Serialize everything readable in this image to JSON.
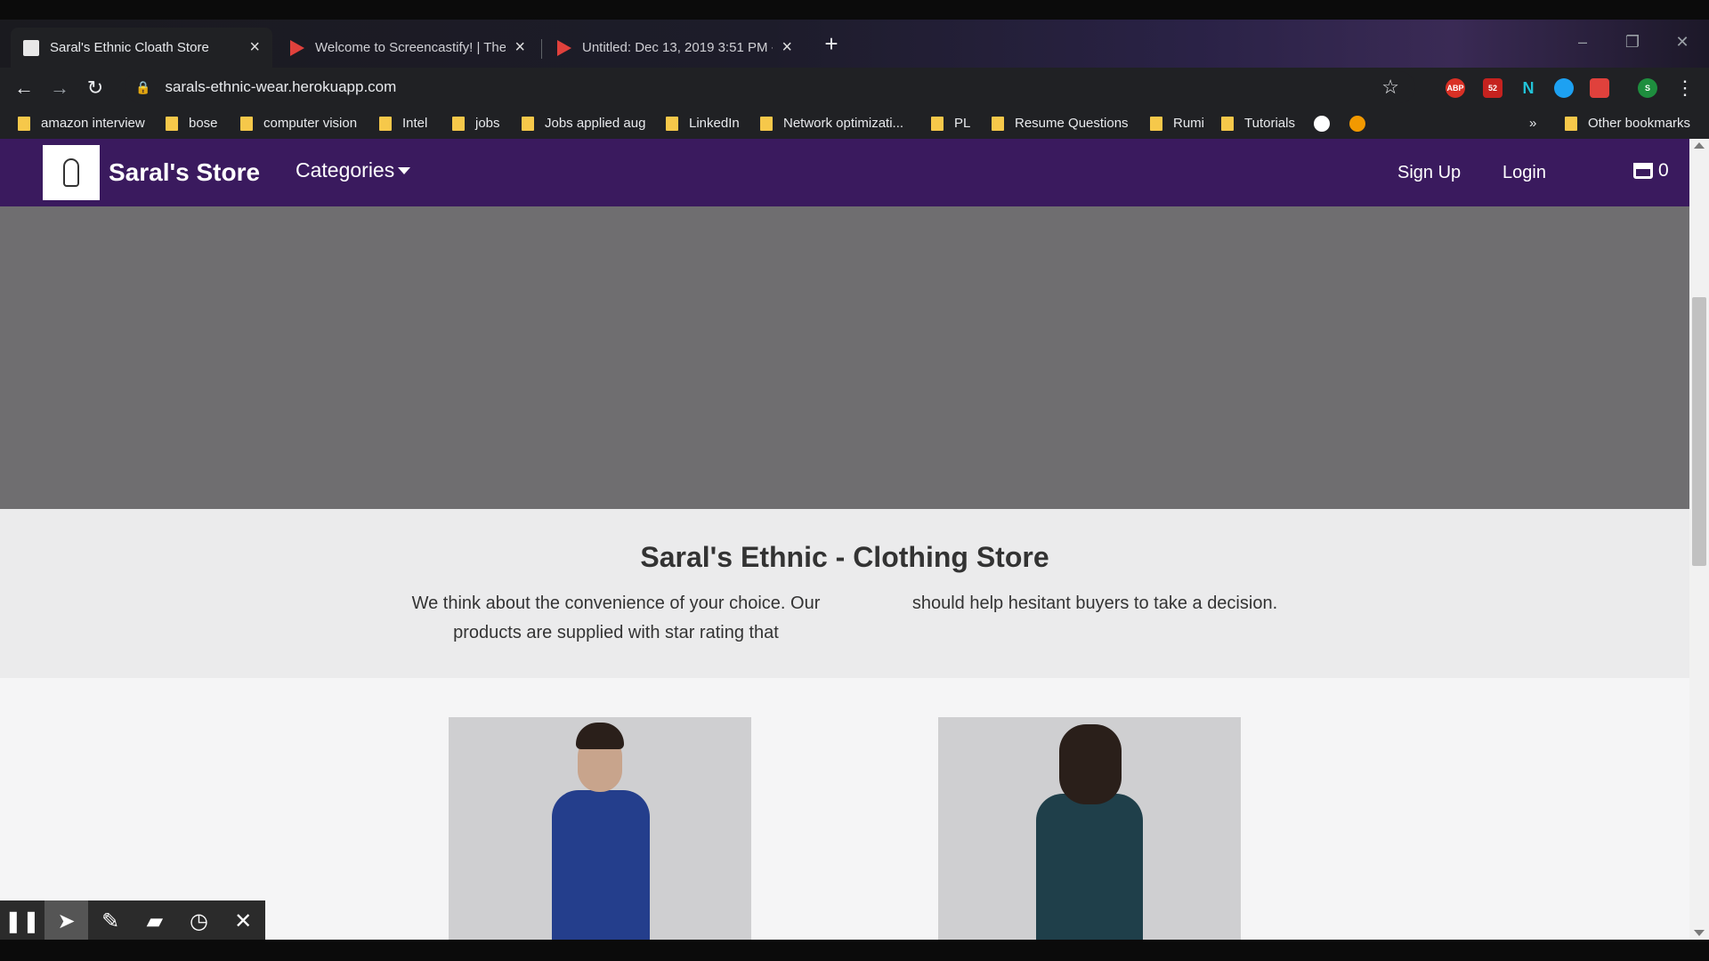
{
  "browser": {
    "tabs": [
      {
        "title": "Saral's Ethnic Cloath Store",
        "active": true
      },
      {
        "title": "Welcome to Screencastify! | The",
        "active": false
      },
      {
        "title": "Untitled: Dec 13, 2019 3:51 PM -",
        "active": false
      }
    ],
    "url": "sarals-ethnic-wear.herokuapp.com",
    "extension_badge": "52",
    "profile_initial": "S",
    "bookmarks": [
      "amazon interview",
      "bose",
      "computer vision",
      "Intel",
      "jobs",
      "Jobs applied aug",
      "LinkedIn",
      "Network optimizati...",
      "PL",
      "Resume Questions",
      "Rumi",
      "Tutorials"
    ],
    "bookmarks_overflow": "»",
    "other_bookmarks": "Other bookmarks"
  },
  "site": {
    "brand": "Saral's Store",
    "categories_label": "Categories",
    "signup_label": "Sign Up",
    "login_label": "Login",
    "cart_count": "0",
    "intro": {
      "title": "Saral's Ethnic - Clothing Store",
      "col1": "We think about the convenience of your choice. Our products are supplied with star rating that",
      "col2": "should help hesitant buyers to take a decision."
    }
  },
  "colors": {
    "navbar": "#3a1a5e",
    "hero": "#6f6e70",
    "page_bg": "#ebebec"
  },
  "recorder": {
    "icons": [
      "pause-icon",
      "cursor-icon",
      "pen-icon",
      "eraser-icon",
      "timer-icon",
      "close-icon"
    ]
  }
}
